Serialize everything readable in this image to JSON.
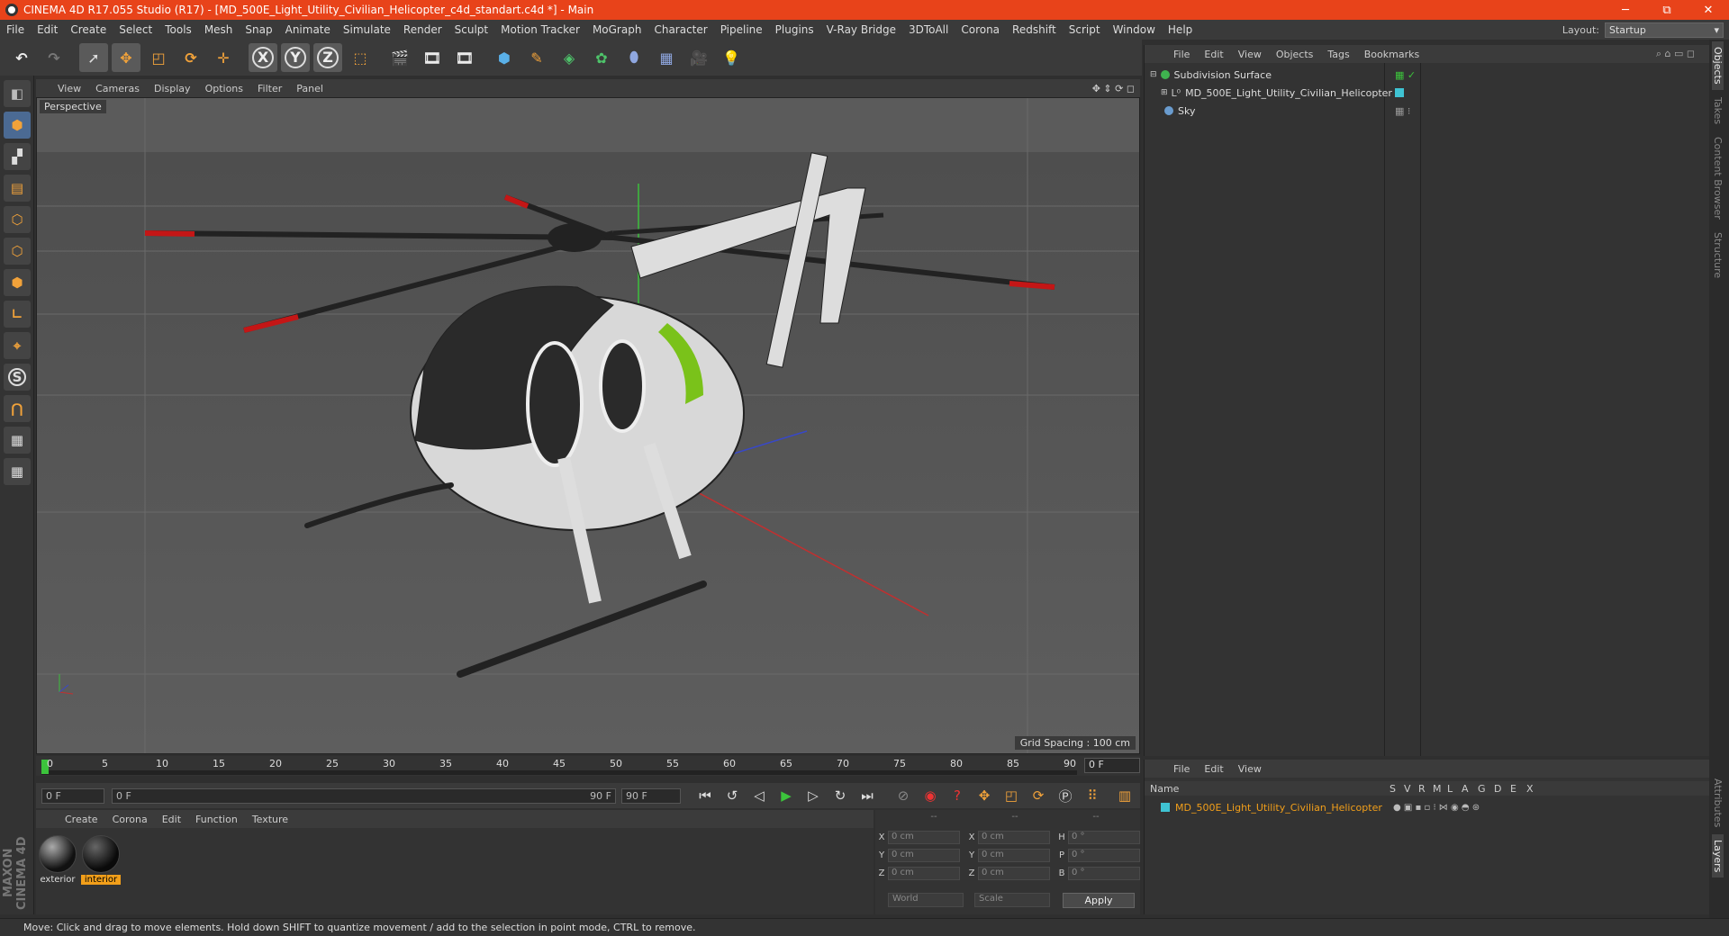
{
  "window": {
    "title": "CINEMA 4D R17.055 Studio (R17) - [MD_500E_Light_Utility_Civilian_Helicopter_c4d_standart.c4d *] - Main",
    "minimize": "─",
    "maximize": "⧉",
    "close": "✕"
  },
  "menubar": {
    "items": [
      "File",
      "Edit",
      "Create",
      "Select",
      "Tools",
      "Mesh",
      "Snap",
      "Animate",
      "Simulate",
      "Render",
      "Sculpt",
      "Motion Tracker",
      "MoGraph",
      "Character",
      "Pipeline",
      "Plugins",
      "V-Ray Bridge",
      "3DToAll",
      "Corona",
      "Redshift",
      "Script",
      "Window",
      "Help"
    ],
    "layout_label": "Layout:",
    "layout_value": "Startup"
  },
  "toolbar": {
    "axis_x": "X",
    "axis_y": "Y",
    "axis_z": "Z"
  },
  "viewport": {
    "menu": [
      "View",
      "Cameras",
      "Display",
      "Options",
      "Filter",
      "Panel"
    ],
    "label": "Perspective",
    "grid_spacing": "Grid Spacing : 100 cm"
  },
  "timeline": {
    "ticks": [
      "0",
      "5",
      "10",
      "15",
      "20",
      "25",
      "30",
      "35",
      "40",
      "45",
      "50",
      "55",
      "60",
      "65",
      "70",
      "75",
      "80",
      "85",
      "90"
    ],
    "current_frame": "0 F"
  },
  "transport": {
    "start": "0 F",
    "range_start": "0 F",
    "range_end": "90 F",
    "end": "90 F"
  },
  "materials": {
    "menu": [
      "Create",
      "Corona",
      "Edit",
      "Function",
      "Texture"
    ],
    "items": [
      {
        "name": "exterior",
        "selected": false
      },
      {
        "name": "interior",
        "selected": true
      }
    ]
  },
  "coords": {
    "header": [
      "--",
      "--",
      "--"
    ],
    "rows": [
      {
        "a1": "X",
        "v1": "0 cm",
        "a2": "X",
        "v2": "0 cm",
        "a3": "H",
        "v3": "0 °"
      },
      {
        "a1": "Y",
        "v1": "0 cm",
        "a2": "Y",
        "v2": "0 cm",
        "a3": "P",
        "v3": "0 °"
      },
      {
        "a1": "Z",
        "v1": "0 cm",
        "a2": "Z",
        "v2": "0 cm",
        "a3": "B",
        "v3": "0 °"
      }
    ],
    "space": "World",
    "mode": "Scale",
    "apply": "Apply"
  },
  "objects": {
    "menu": [
      "File",
      "Edit",
      "View",
      "Objects",
      "Tags",
      "Bookmarks"
    ],
    "items": [
      {
        "name": "Subdivision Surface",
        "color": "#3fb24f"
      },
      {
        "name": "MD_500E_Light_Utility_Civilian_Helicopter",
        "color": "#7a7a7a"
      },
      {
        "name": "Sky",
        "color": "#6a9ccf"
      }
    ]
  },
  "layers": {
    "menu": [
      "File",
      "Edit",
      "View"
    ],
    "columns": [
      "Name",
      "S",
      "V",
      "R",
      "M",
      "L",
      "A",
      "G",
      "D",
      "E",
      "X"
    ],
    "items": [
      {
        "name": "MD_500E_Light_Utility_Civilian_Helicopter",
        "color": "#3fc3d3"
      }
    ]
  },
  "dock_tabs": [
    "Objects",
    "Takes",
    "Content Browser",
    "Structure",
    "Attributes",
    "Layers"
  ],
  "status": "Move: Click and drag to move elements. Hold down SHIFT to quantize movement / add to the selection in point mode, CTRL to remove.",
  "logo": "MAXON CINEMA 4D",
  "colors": {
    "titlebar": "#e8431a",
    "accent_orange": "#f29f1a",
    "viewport_bg": "#5b5b5b"
  }
}
